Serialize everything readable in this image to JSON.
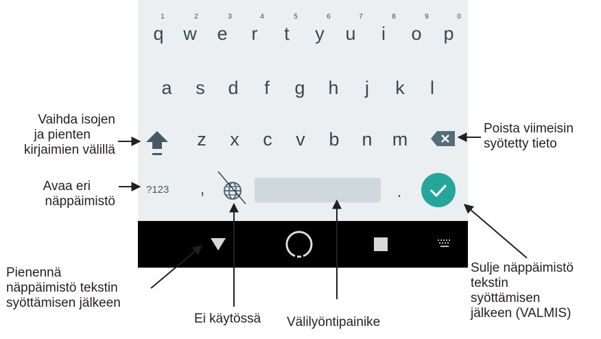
{
  "keyboard": {
    "row1": [
      "q",
      "w",
      "e",
      "r",
      "t",
      "y",
      "u",
      "i",
      "o",
      "p"
    ],
    "hints": [
      "1",
      "2",
      "3",
      "4",
      "5",
      "6",
      "7",
      "8",
      "9",
      "0"
    ],
    "row2": [
      "a",
      "s",
      "d",
      "f",
      "g",
      "h",
      "j",
      "k",
      "l"
    ],
    "row3": [
      "z",
      "x",
      "c",
      "v",
      "b",
      "n",
      "m"
    ],
    "symbols_label": "?123",
    "comma": ",",
    "period": ".",
    "accent_color": "#26a69a"
  },
  "icons": {
    "shift": "shift-icon",
    "backspace": "backspace-icon",
    "globe": "globe-icon",
    "enter": "checkmark-icon",
    "back": "triangle-down-icon",
    "home": "circle-icon",
    "recents": "square-icon",
    "keyboard": "keyboard-icon"
  },
  "annotations": {
    "shift_l1": "Vaihda isojen",
    "shift_l2": "ja pienten",
    "shift_l3": "kirjaimien välillä",
    "symbols_l1": "Avaa eri",
    "symbols_l2": "näppäimistö",
    "minimize_l1": "Pienennä",
    "minimize_l2": "näppäimistö tekstin",
    "minimize_l3": "syöttämisen jälkeen",
    "globe": "Ei käytössä",
    "space": "Välilyöntipainike",
    "backspace_l1": "Poista viimeisin",
    "backspace_l2": "syötetty tieto",
    "enter_l1": "Sulje näppäimistö",
    "enter_l2": "tekstin",
    "enter_l3": "syöttämisen",
    "enter_l4": "jälkeen (VALMIS)"
  }
}
